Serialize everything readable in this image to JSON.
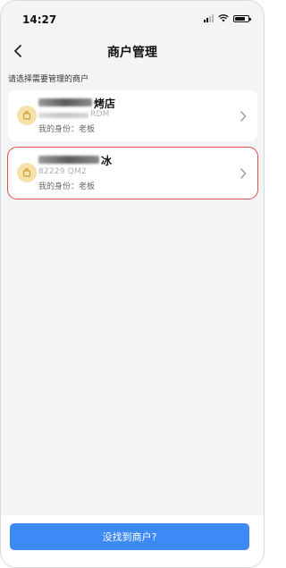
{
  "status_bar": {
    "time": "14:27"
  },
  "nav": {
    "title": "商户管理"
  },
  "hint": "请选择需要管理的商户",
  "merchants": [
    {
      "name": "烤店",
      "code": "RDM",
      "role": "我的身份：老板"
    },
    {
      "name": "冰",
      "code": "82229 QM2",
      "role": "我的身份：老板"
    }
  ],
  "footer": {
    "button_label": "没找到商户?"
  },
  "colors": {
    "accent": "#3d8af7",
    "selected_border": "#e0504a",
    "icon_bg": "#f5e2a8"
  }
}
